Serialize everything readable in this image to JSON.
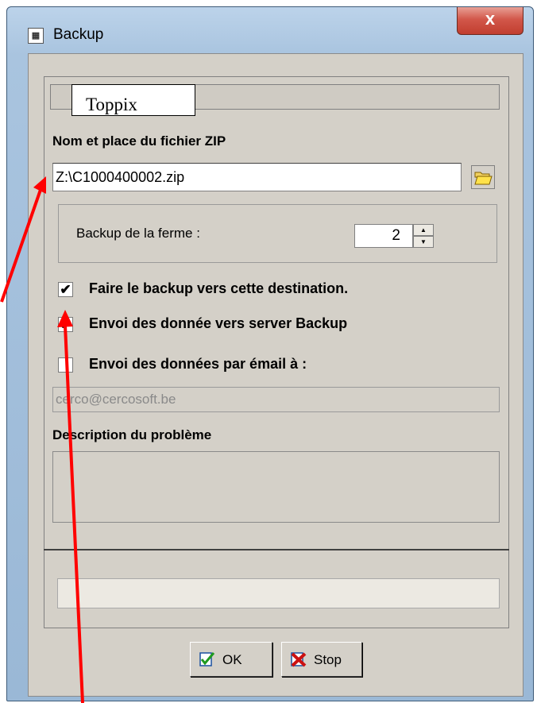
{
  "window": {
    "title": "Backup",
    "close_label": "x"
  },
  "header": {
    "label": "Toppix"
  },
  "zip": {
    "label": "Nom et place du fichier ZIP",
    "value": "Z:\\C1000400002.zip"
  },
  "farm_backup": {
    "label": "Backup de la ferme :",
    "value": "2"
  },
  "options": [
    {
      "label": "Faire le backup vers cette destination.",
      "checked": true
    },
    {
      "label": "Envoi des donnée vers server Backup",
      "checked": true
    },
    {
      "label": "Envoi des données par émail à :",
      "checked": false
    }
  ],
  "email": {
    "value": "cerco@cercosoft.be"
  },
  "description": {
    "label": "Description du problème",
    "value": ""
  },
  "status": {
    "value": ""
  },
  "buttons": {
    "ok_label": "OK",
    "stop_label": "Stop"
  },
  "annotation": {
    "arrow_color": "#ff0000"
  }
}
